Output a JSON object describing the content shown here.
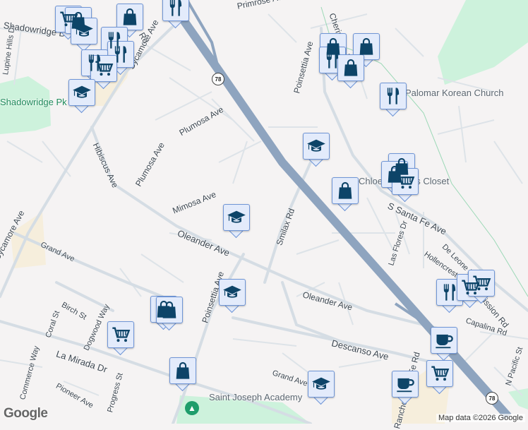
{
  "colors": {
    "background": "#f5f3f3",
    "road": "#d5dde4",
    "highway": "#8ea4bf",
    "park": "#cdf2dc",
    "commercial": "#f6eedc",
    "marker_fill": "#e3ebfb",
    "marker_border": "#6f95d6",
    "icon": "#0d4468"
  },
  "streets": {
    "shadowridge": "Shadowridge Dr",
    "lupine": "Lupine Hills Dr",
    "sycamore_top": "Sycamore Ave",
    "sycamore_bottom": "Sycamore Ave",
    "rd_top": "Rd",
    "hibiscus": "Hibiscus Ave",
    "plumosa1": "Plumosa Ave",
    "plumosa2": "Plumosa Ave",
    "mimosa": "Mimosa Ave",
    "primrose": "Primrose Ave",
    "chermoya": "Cherimoya Dr",
    "poinsettia_top": "Poinsettia Ave",
    "poinsettia_bottom": "Poinsettia Ave",
    "smilax": "Smilax Rd",
    "oleander1": "Oleander Ave",
    "oleander2": "Oleander Ave",
    "santa_fe": "S Santa Fe Ave",
    "las_flores": "Las Flores Dr",
    "de_leone": "De Leone Rd",
    "hollencrest": "Hollencrest Dr",
    "mission": "Mission Rd",
    "capalina": "Capalina Rd",
    "n_pacific": "N Pacific St",
    "grand1": "Grand Ave",
    "grand2": "Grand Ave",
    "birch": "Birch St",
    "coral": "Coral St",
    "dogwood": "Dogwood Way",
    "commerce": "Commerce Way",
    "la_mirada": "La Mirada Dr",
    "pioneer": "Pioneer Ave",
    "progress": "Progress St",
    "descanso": "Descanso Ave",
    "rancho_santa_fe": "Rancho Santa Fe Rd"
  },
  "pois": {
    "shadowridge_park": "Shadowridge Pk",
    "palomar_church": "Palomar Korean Church",
    "closet": "Chloe & Belle's Closet",
    "saint_joseph": "Saint Joseph Academy"
  },
  "highway_shield": "78",
  "markers": [
    "cart",
    "shop",
    "school",
    "shop",
    "restaurant",
    "restaurant",
    "restaurant",
    "cart",
    "school",
    "restaurant",
    "shop",
    "restaurant",
    "shop",
    "shop",
    "restaurant",
    "school",
    "shop",
    "shop",
    "shop",
    "cart",
    "school",
    "school",
    "shop",
    "shop",
    "cart",
    "shop",
    "school",
    "restaurant",
    "cart",
    "cart",
    "coffee",
    "cart",
    "coffee"
  ],
  "attribution": "Map data ©2026 Google",
  "logo": "Google"
}
